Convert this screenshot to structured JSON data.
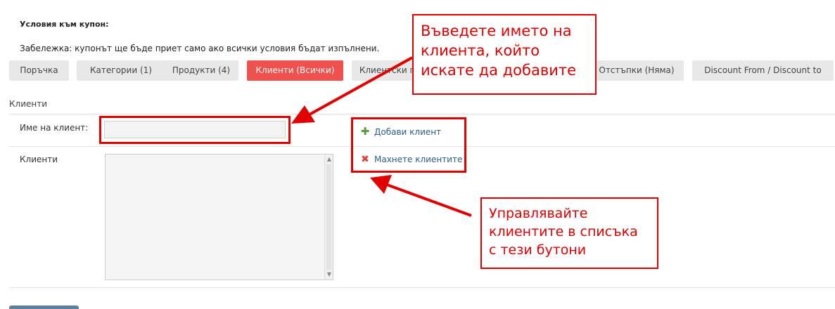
{
  "page": {
    "heading": "Условия към купон:",
    "note": "Забележка: купонът ще бъде приет само ако всички условия бъдат изпълнени."
  },
  "tabs": [
    {
      "label": "Поръчка",
      "active": false
    },
    {
      "label": "Категории (1)",
      "active": false
    },
    {
      "label": "Продукти (4)",
      "active": false
    },
    {
      "label": "Клиенти (Всички)",
      "active": true
    },
    {
      "label": "Клиентски групи",
      "active": false
    },
    {
      "label": "Отстъпки (Няма)",
      "active": false
    },
    {
      "label": "Discount From / Discount to",
      "active": false
    }
  ],
  "section": {
    "title": "Клиенти",
    "customer_name_label": "Име на клиент:",
    "customer_name_value": "",
    "customers_label": "Клиенти"
  },
  "actions": {
    "add_customer": "Добави клиент",
    "remove_customers": "Махнете клиентите"
  },
  "annotations": {
    "top": [
      "Въведете името на",
      "клиента, който",
      "искате да добавите"
    ],
    "bottom": [
      "Управлявайте",
      "клиентите в списъка",
      "с тези бутони"
    ]
  },
  "colors": {
    "accent": "#f0514e",
    "annotation": "#e20000",
    "link": "#2a5d8c",
    "add_icon": "#5a9a3c",
    "remove_icon": "#e0403a"
  },
  "icons": {
    "add": "plus-icon",
    "remove": "cross-icon"
  }
}
